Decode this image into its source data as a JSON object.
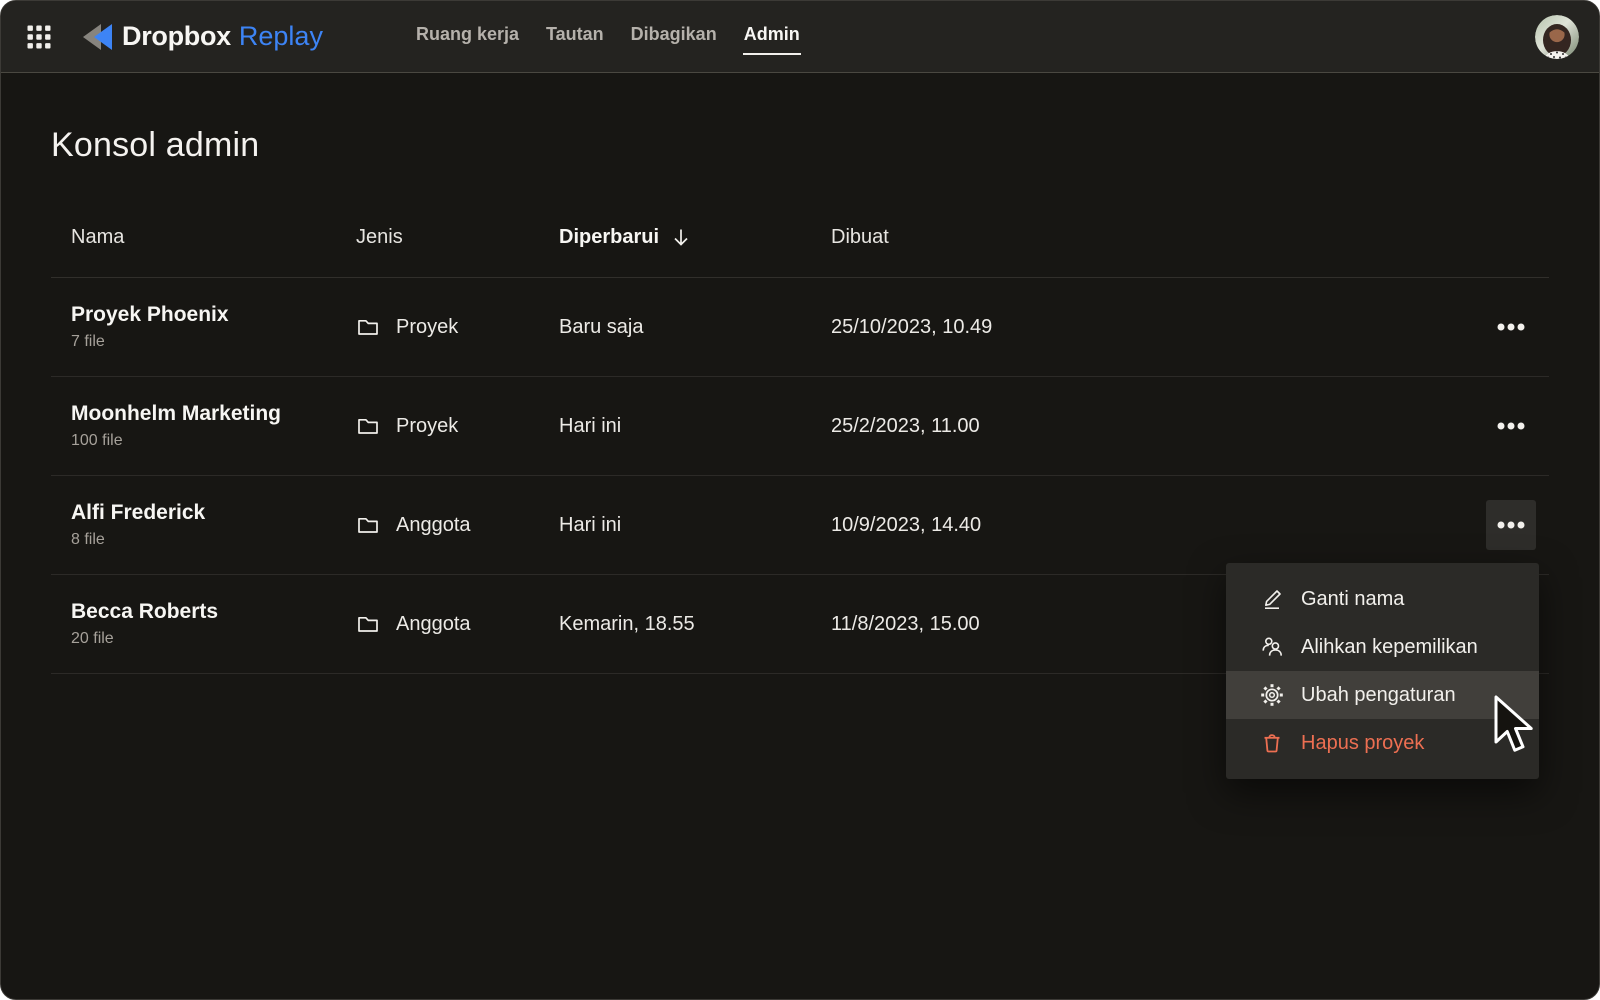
{
  "topbar": {
    "brand": {
      "word1": "Dropbox",
      "word2": "Replay",
      "mark_icon": "replay-rewind-icon"
    },
    "apps_icon": "apps-grid-icon",
    "nav_items": [
      {
        "label": "Ruang kerja",
        "active": false
      },
      {
        "label": "Tautan",
        "active": false
      },
      {
        "label": "Dibagikan",
        "active": false
      },
      {
        "label": "Admin",
        "active": true
      }
    ],
    "avatar_icon": "user-avatar"
  },
  "page": {
    "title": "Konsol admin"
  },
  "table": {
    "columns": [
      {
        "label": "Nama",
        "sorted": false
      },
      {
        "label": "Jenis",
        "sorted": false
      },
      {
        "label": "Diperbarui",
        "sorted": true,
        "sort_icon": "arrow-down-icon"
      },
      {
        "label": "Dibuat",
        "sorted": false
      }
    ],
    "row_actions_icon": "ellipsis-icon",
    "type_icon": "folder-icon",
    "rows": [
      {
        "name": "Proyek Phoenix",
        "files": "7 file",
        "type": "Proyek",
        "updated": "Baru saja",
        "created": "25/10/2023, 10.49",
        "menu_open": false
      },
      {
        "name": "Moonhelm Marketing",
        "files": "100 file",
        "type": "Proyek",
        "updated": "Hari ini",
        "created": "25/2/2023, 11.00",
        "menu_open": false
      },
      {
        "name": "Alfi Frederick",
        "files": "8 file",
        "type": "Anggota",
        "updated": "Hari ini",
        "created": "10/9/2023, 14.40",
        "menu_open": true
      },
      {
        "name": "Becca Roberts",
        "files": "20 file",
        "type": "Anggota",
        "updated": "Kemarin, 18.55",
        "created": "11/8/2023, 15.00",
        "menu_open": false
      }
    ]
  },
  "context_menu": {
    "items": [
      {
        "label": "Ganti nama",
        "icon": "pencil-icon",
        "highlighted": false,
        "danger": false
      },
      {
        "label": "Alihkan kepemilikan",
        "icon": "transfer-ownership-icon",
        "highlighted": false,
        "danger": false
      },
      {
        "label": "Ubah pengaturan",
        "icon": "gear-icon",
        "highlighted": true,
        "danger": false
      },
      {
        "label": "Hapus proyek",
        "icon": "trash-icon",
        "highlighted": false,
        "danger": true
      }
    ]
  },
  "colors": {
    "accent_blue": "#3d84f5",
    "danger_orange": "#ed6f52",
    "app_background": "#171613",
    "topbar_background": "#242320",
    "menu_background": "#2b2a27",
    "menu_highlight": "#413f3b"
  }
}
